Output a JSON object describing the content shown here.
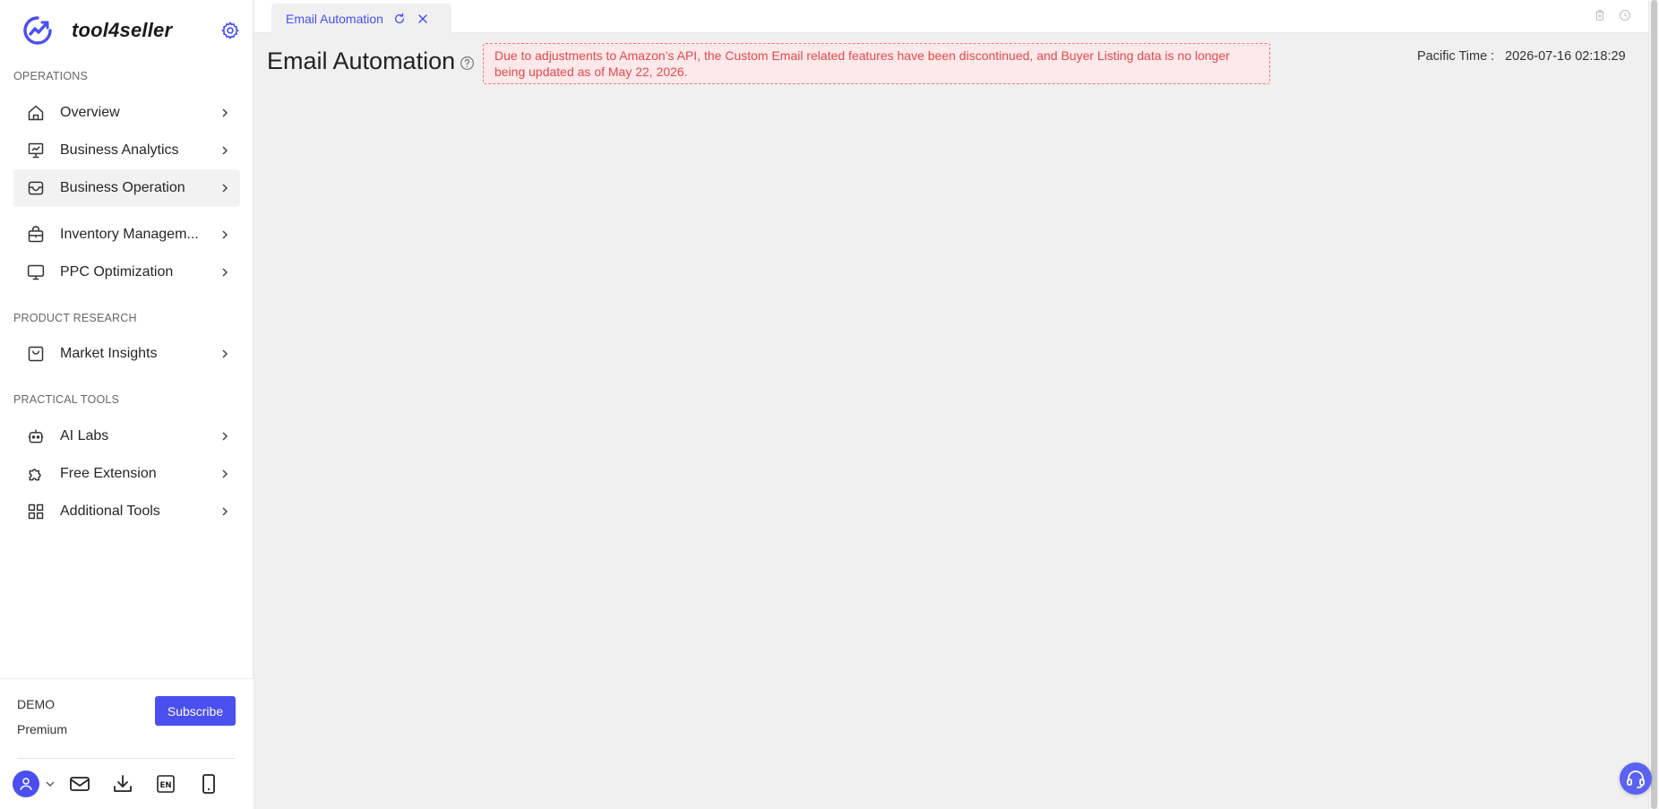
{
  "brand": {
    "name": "tool4seller",
    "accent": "#4b4ff0"
  },
  "sidebar": {
    "sections": {
      "operations": "OPERATIONS",
      "product_research": "PRODUCT RESEARCH",
      "practical_tools": "PRACTICAL TOOLS"
    },
    "items": [
      {
        "label": "Overview",
        "icon": "home-icon"
      },
      {
        "label": "Business Analytics",
        "icon": "presentation-chart-icon"
      },
      {
        "label": "Business Operation",
        "icon": "storefront-icon",
        "active": true
      },
      {
        "label": "Inventory Managem...",
        "icon": "package-icon"
      },
      {
        "label": "PPC Optimization",
        "icon": "monitor-icon"
      },
      {
        "label": "Market Insights",
        "icon": "shopping-bag-icon"
      },
      {
        "label": "AI Labs",
        "icon": "robot-icon"
      },
      {
        "label": "Free Extension",
        "icon": "puzzle-icon"
      },
      {
        "label": "Additional Tools",
        "icon": "grid-icon"
      }
    ],
    "account": {
      "name": "DEMO",
      "plan": "Premium",
      "subscribe_label": "Subscribe"
    },
    "bottom_icons": [
      "user-avatar-icon",
      "mail-icon",
      "download-icon",
      "language-en-icon",
      "mobile-phone-icon"
    ]
  },
  "tabs": [
    {
      "label": "Email Automation",
      "active": true
    }
  ],
  "main": {
    "title": "Email Automation",
    "notice": "Due to adjustments to Amazon’s API, the Custom Email related features have been discontinued, and Buyer Listing data is no longer being updated as of May 22, 2026.",
    "time_label": "Pacific Time :",
    "time_value": "2026-07-16 02:18:29"
  },
  "colors": {
    "notice_text": "#e5484d",
    "notice_bg": "#fde9e9",
    "notice_border": "#f07a7a",
    "subscribe_bg": "#4b4ff0"
  }
}
